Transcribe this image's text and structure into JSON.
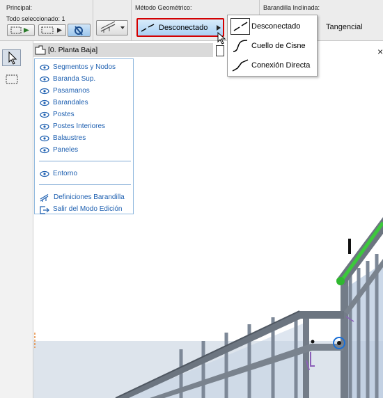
{
  "toolbar": {
    "principal": {
      "title": "Principal:",
      "selection_text": "Todo seleccionado: 1"
    },
    "geometry": {
      "title": "Método Geométrico:",
      "current_value": "Desconectado"
    },
    "inclined": {
      "title": "Barandilla Inclinada:",
      "tangential_label": "Tangencial"
    }
  },
  "dropdown": {
    "items": [
      {
        "label": "Desconectado",
        "icon": "disconnected-icon"
      },
      {
        "label": "Cuello de Cisne",
        "icon": "gooseneck-icon"
      },
      {
        "label": "Conexión Directa",
        "icon": "direct-connection-icon"
      }
    ]
  },
  "viewport": {
    "close_label": "×"
  },
  "floor": {
    "label": "[0. Planta Baja]"
  },
  "context_panel": {
    "items": [
      {
        "label": "Segmentos y Nodos",
        "icon": "eye-icon"
      },
      {
        "label": "Baranda Sup.",
        "icon": "eye-icon"
      },
      {
        "label": "Pasamanos",
        "icon": "eye-icon"
      },
      {
        "label": "Barandales",
        "icon": "eye-icon"
      },
      {
        "label": "Postes",
        "icon": "eye-icon"
      },
      {
        "label": "Postes Interiores",
        "icon": "eye-icon"
      },
      {
        "label": "Balaustres",
        "icon": "eye-icon"
      },
      {
        "label": "Paneles",
        "icon": "eye-icon"
      }
    ],
    "surroundings": {
      "label": "Entorno",
      "icon": "eye-icon"
    },
    "railing_settings": {
      "label": "Definiciones Barandilla",
      "icon": "railing-settings-icon"
    },
    "exit_edit": {
      "label": "Salir del Modo Edición",
      "icon": "exit-icon"
    }
  },
  "colors": {
    "highlight_red": "#d40000",
    "link_blue": "#1d5fb0",
    "selected_green": "#3cc83c",
    "node_blue": "#1a6fd6"
  }
}
